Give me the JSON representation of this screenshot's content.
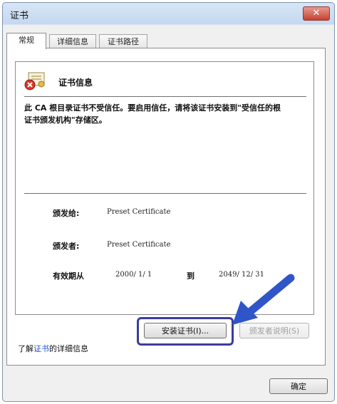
{
  "window": {
    "title": "证书",
    "close_glyph": "✕"
  },
  "tabs": [
    {
      "label": "常规",
      "active": true
    },
    {
      "label": "详细信息",
      "active": false
    },
    {
      "label": "证书路径",
      "active": false
    }
  ],
  "info": {
    "heading": "证书信息",
    "warning": "此 CA 根目录证书不受信任。要启用信任，请将该证书安装到\"受信任的根证书颁发机构\"存储区。"
  },
  "details": {
    "issued_to_label": "颁发给:",
    "issued_to_value": "Preset Certificate",
    "issued_by_label": "颁发者:",
    "issued_by_value": "Preset Certificate",
    "validity_label": "有效期从",
    "valid_from": "2000/ 1/ 1",
    "to_word": "到",
    "valid_to": "2049/ 12/ 31"
  },
  "buttons": {
    "install": "安装证书(I)...",
    "issuer_statement": "颁发者说明(S)",
    "ok": "确定"
  },
  "learn_more": {
    "prefix": "了解",
    "link": "证书",
    "suffix": "的详细信息"
  },
  "colors": {
    "highlight": "#3c3c9c",
    "arrow": "#2f55c8",
    "title_bar": "#c4d8ef"
  }
}
